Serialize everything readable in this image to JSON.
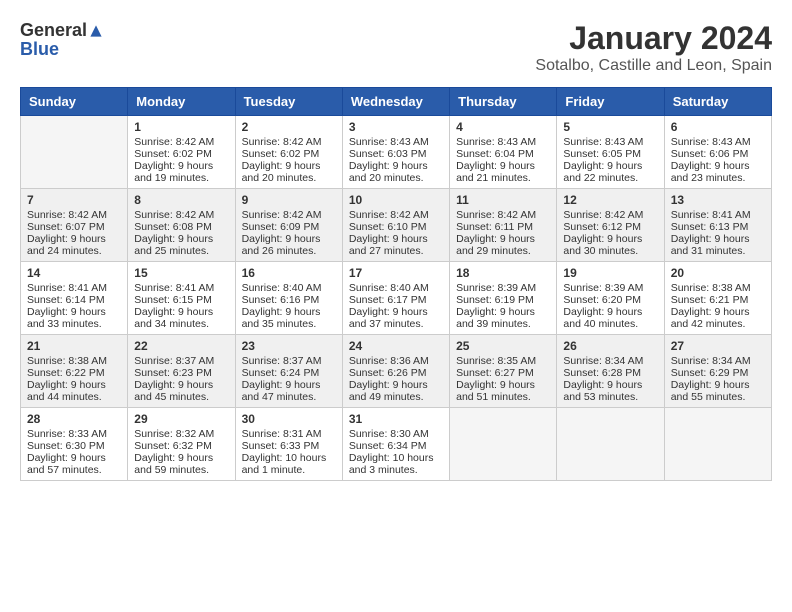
{
  "logo": {
    "general": "General",
    "blue": "Blue"
  },
  "title": "January 2024",
  "subtitle": "Sotalbo, Castille and Leon, Spain",
  "days_of_week": [
    "Sunday",
    "Monday",
    "Tuesday",
    "Wednesday",
    "Thursday",
    "Friday",
    "Saturday"
  ],
  "weeks": [
    [
      {
        "day": "",
        "sunrise": "",
        "sunset": "",
        "daylight": ""
      },
      {
        "day": "1",
        "sunrise": "Sunrise: 8:42 AM",
        "sunset": "Sunset: 6:02 PM",
        "daylight": "Daylight: 9 hours and 19 minutes."
      },
      {
        "day": "2",
        "sunrise": "Sunrise: 8:42 AM",
        "sunset": "Sunset: 6:02 PM",
        "daylight": "Daylight: 9 hours and 20 minutes."
      },
      {
        "day": "3",
        "sunrise": "Sunrise: 8:43 AM",
        "sunset": "Sunset: 6:03 PM",
        "daylight": "Daylight: 9 hours and 20 minutes."
      },
      {
        "day": "4",
        "sunrise": "Sunrise: 8:43 AM",
        "sunset": "Sunset: 6:04 PM",
        "daylight": "Daylight: 9 hours and 21 minutes."
      },
      {
        "day": "5",
        "sunrise": "Sunrise: 8:43 AM",
        "sunset": "Sunset: 6:05 PM",
        "daylight": "Daylight: 9 hours and 22 minutes."
      },
      {
        "day": "6",
        "sunrise": "Sunrise: 8:43 AM",
        "sunset": "Sunset: 6:06 PM",
        "daylight": "Daylight: 9 hours and 23 minutes."
      }
    ],
    [
      {
        "day": "7",
        "sunrise": "Sunrise: 8:42 AM",
        "sunset": "Sunset: 6:07 PM",
        "daylight": "Daylight: 9 hours and 24 minutes."
      },
      {
        "day": "8",
        "sunrise": "Sunrise: 8:42 AM",
        "sunset": "Sunset: 6:08 PM",
        "daylight": "Daylight: 9 hours and 25 minutes."
      },
      {
        "day": "9",
        "sunrise": "Sunrise: 8:42 AM",
        "sunset": "Sunset: 6:09 PM",
        "daylight": "Daylight: 9 hours and 26 minutes."
      },
      {
        "day": "10",
        "sunrise": "Sunrise: 8:42 AM",
        "sunset": "Sunset: 6:10 PM",
        "daylight": "Daylight: 9 hours and 27 minutes."
      },
      {
        "day": "11",
        "sunrise": "Sunrise: 8:42 AM",
        "sunset": "Sunset: 6:11 PM",
        "daylight": "Daylight: 9 hours and 29 minutes."
      },
      {
        "day": "12",
        "sunrise": "Sunrise: 8:42 AM",
        "sunset": "Sunset: 6:12 PM",
        "daylight": "Daylight: 9 hours and 30 minutes."
      },
      {
        "day": "13",
        "sunrise": "Sunrise: 8:41 AM",
        "sunset": "Sunset: 6:13 PM",
        "daylight": "Daylight: 9 hours and 31 minutes."
      }
    ],
    [
      {
        "day": "14",
        "sunrise": "Sunrise: 8:41 AM",
        "sunset": "Sunset: 6:14 PM",
        "daylight": "Daylight: 9 hours and 33 minutes."
      },
      {
        "day": "15",
        "sunrise": "Sunrise: 8:41 AM",
        "sunset": "Sunset: 6:15 PM",
        "daylight": "Daylight: 9 hours and 34 minutes."
      },
      {
        "day": "16",
        "sunrise": "Sunrise: 8:40 AM",
        "sunset": "Sunset: 6:16 PM",
        "daylight": "Daylight: 9 hours and 35 minutes."
      },
      {
        "day": "17",
        "sunrise": "Sunrise: 8:40 AM",
        "sunset": "Sunset: 6:17 PM",
        "daylight": "Daylight: 9 hours and 37 minutes."
      },
      {
        "day": "18",
        "sunrise": "Sunrise: 8:39 AM",
        "sunset": "Sunset: 6:19 PM",
        "daylight": "Daylight: 9 hours and 39 minutes."
      },
      {
        "day": "19",
        "sunrise": "Sunrise: 8:39 AM",
        "sunset": "Sunset: 6:20 PM",
        "daylight": "Daylight: 9 hours and 40 minutes."
      },
      {
        "day": "20",
        "sunrise": "Sunrise: 8:38 AM",
        "sunset": "Sunset: 6:21 PM",
        "daylight": "Daylight: 9 hours and 42 minutes."
      }
    ],
    [
      {
        "day": "21",
        "sunrise": "Sunrise: 8:38 AM",
        "sunset": "Sunset: 6:22 PM",
        "daylight": "Daylight: 9 hours and 44 minutes."
      },
      {
        "day": "22",
        "sunrise": "Sunrise: 8:37 AM",
        "sunset": "Sunset: 6:23 PM",
        "daylight": "Daylight: 9 hours and 45 minutes."
      },
      {
        "day": "23",
        "sunrise": "Sunrise: 8:37 AM",
        "sunset": "Sunset: 6:24 PM",
        "daylight": "Daylight: 9 hours and 47 minutes."
      },
      {
        "day": "24",
        "sunrise": "Sunrise: 8:36 AM",
        "sunset": "Sunset: 6:26 PM",
        "daylight": "Daylight: 9 hours and 49 minutes."
      },
      {
        "day": "25",
        "sunrise": "Sunrise: 8:35 AM",
        "sunset": "Sunset: 6:27 PM",
        "daylight": "Daylight: 9 hours and 51 minutes."
      },
      {
        "day": "26",
        "sunrise": "Sunrise: 8:34 AM",
        "sunset": "Sunset: 6:28 PM",
        "daylight": "Daylight: 9 hours and 53 minutes."
      },
      {
        "day": "27",
        "sunrise": "Sunrise: 8:34 AM",
        "sunset": "Sunset: 6:29 PM",
        "daylight": "Daylight: 9 hours and 55 minutes."
      }
    ],
    [
      {
        "day": "28",
        "sunrise": "Sunrise: 8:33 AM",
        "sunset": "Sunset: 6:30 PM",
        "daylight": "Daylight: 9 hours and 57 minutes."
      },
      {
        "day": "29",
        "sunrise": "Sunrise: 8:32 AM",
        "sunset": "Sunset: 6:32 PM",
        "daylight": "Daylight: 9 hours and 59 minutes."
      },
      {
        "day": "30",
        "sunrise": "Sunrise: 8:31 AM",
        "sunset": "Sunset: 6:33 PM",
        "daylight": "Daylight: 10 hours and 1 minute."
      },
      {
        "day": "31",
        "sunrise": "Sunrise: 8:30 AM",
        "sunset": "Sunset: 6:34 PM",
        "daylight": "Daylight: 10 hours and 3 minutes."
      },
      {
        "day": "",
        "sunrise": "",
        "sunset": "",
        "daylight": ""
      },
      {
        "day": "",
        "sunrise": "",
        "sunset": "",
        "daylight": ""
      },
      {
        "day": "",
        "sunrise": "",
        "sunset": "",
        "daylight": ""
      }
    ]
  ]
}
